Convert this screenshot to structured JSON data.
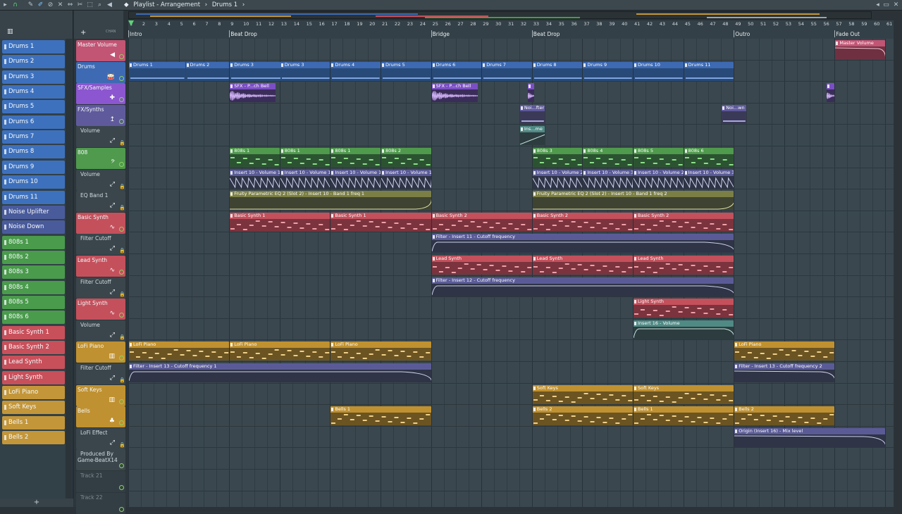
{
  "window": {
    "title": "Playlist - Arrangement",
    "pattern": "Drums 1",
    "separator": "›"
  },
  "header": {
    "chan_label": "CHAN",
    "add_label": "+"
  },
  "picker": {
    "items": [
      {
        "label": "Drums 1",
        "color": "#3e71bd"
      },
      {
        "label": "Drums 2",
        "color": "#3e71bd"
      },
      {
        "label": "Drums 3",
        "color": "#3e71bd"
      },
      {
        "label": "Drums 4",
        "color": "#3e71bd"
      },
      {
        "label": "Drums 5",
        "color": "#3e71bd"
      },
      {
        "label": "Drums 6",
        "color": "#3e71bd"
      },
      {
        "label": "Drums 7",
        "color": "#3e71bd"
      },
      {
        "label": "Drums 8",
        "color": "#3e71bd"
      },
      {
        "label": "Drums 9",
        "color": "#3e71bd"
      },
      {
        "label": "Drums 10",
        "color": "#3e71bd"
      },
      {
        "label": "Drums 11",
        "color": "#3e71bd"
      },
      {
        "label": "Noise Uplifter",
        "color": "#4a5b9c"
      },
      {
        "label": "Noise Down",
        "color": "#4a5b9c"
      },
      {
        "label": "808s 1",
        "color": "#4a9b4c"
      },
      {
        "label": "808s 2",
        "color": "#4a9b4c"
      },
      {
        "label": "808s 3",
        "color": "#4a9b4c"
      },
      {
        "label": "808s 4",
        "color": "#4a9b4c"
      },
      {
        "label": "808s 5",
        "color": "#4a9b4c"
      },
      {
        "label": "808s 6",
        "color": "#4a9b4c"
      },
      {
        "label": "Basic Synth 1",
        "color": "#c8505b"
      },
      {
        "label": "Basic Synth 2",
        "color": "#c8505b"
      },
      {
        "label": "Lead Synth",
        "color": "#c8505b"
      },
      {
        "label": "Light Synth",
        "color": "#c8505b"
      },
      {
        "label": "LoFi Piano",
        "color": "#c3963a"
      },
      {
        "label": "Soft Keys",
        "color": "#c3963a"
      },
      {
        "label": "Bells 1",
        "color": "#c3963a"
      },
      {
        "label": "Bells 2",
        "color": "#c3963a"
      }
    ],
    "add_button": "+"
  },
  "ruler": {
    "bars": [
      "1",
      "2",
      "3",
      "4",
      "5",
      "6",
      "7",
      "8",
      "9",
      "10",
      "11",
      "12",
      "13",
      "14",
      "15",
      "16",
      "17",
      "18",
      "19",
      "20",
      "21",
      "22",
      "23",
      "24",
      "25",
      "26",
      "27",
      "28",
      "29",
      "30",
      "31",
      "32",
      "33",
      "34",
      "35",
      "36",
      "37",
      "38",
      "39",
      "40",
      "41",
      "42",
      "43",
      "44",
      "45",
      "46",
      "47",
      "48",
      "49",
      "50",
      "51",
      "52",
      "53",
      "54",
      "55",
      "56",
      "57",
      "58",
      "59",
      "60",
      "61"
    ],
    "markers": [
      {
        "label": "Intro",
        "bar": 1
      },
      {
        "label": "Beat Drop",
        "bar": 9
      },
      {
        "label": "Bridge",
        "bar": 25
      },
      {
        "label": "Beat Drop",
        "bar": 33
      },
      {
        "label": "Outro",
        "bar": 49
      },
      {
        "label": "Fade Out",
        "bar": 57
      }
    ]
  },
  "tracks": [
    {
      "name": "Master Volume",
      "color": "#c25474",
      "icon": "◀",
      "kind": "led"
    },
    {
      "name": "Drums",
      "color": "#3d6ab3",
      "icon": "🥁",
      "kind": "led"
    },
    {
      "name": "SFX/Samples",
      "color": "#8b56cf",
      "icon": "✚",
      "kind": "led"
    },
    {
      "name": "FX/Synths",
      "color": "#5f5a9c",
      "icon": "↥",
      "kind": "led"
    },
    {
      "name": "Volume",
      "color": "",
      "icon": "⤢",
      "kind": "lock"
    },
    {
      "name": "808",
      "color": "#4f9a4d",
      "icon": "𝄢",
      "kind": "led"
    },
    {
      "name": "Volume",
      "color": "",
      "icon": "⤢",
      "kind": "lock"
    },
    {
      "name": "EQ Band 1",
      "color": "",
      "icon": "⤢",
      "kind": "lock"
    },
    {
      "name": "Basic Synth",
      "color": "#c4505c",
      "icon": "∿",
      "kind": "led"
    },
    {
      "name": "Filter Cutoff",
      "color": "",
      "icon": "⤢",
      "kind": "lock"
    },
    {
      "name": "Lead Synth",
      "color": "#c4505c",
      "icon": "∿",
      "kind": "led"
    },
    {
      "name": "Filter Cutoff",
      "color": "",
      "icon": "⤢",
      "kind": "lock"
    },
    {
      "name": "Light Synth",
      "color": "#c4505c",
      "icon": "∿",
      "kind": "led"
    },
    {
      "name": "Volume",
      "color": "",
      "icon": "⤢",
      "kind": "lock"
    },
    {
      "name": "LoFi Piano",
      "color": "#c09130",
      "icon": "▥",
      "kind": "led"
    },
    {
      "name": "Filter Cutoff",
      "color": "",
      "icon": "⤢",
      "kind": "lock"
    },
    {
      "name": "Soft Keys",
      "color": "#c09130",
      "icon": "▥",
      "kind": "led"
    },
    {
      "name": "Bells",
      "color": "#c09130",
      "icon": "♣",
      "kind": "led"
    },
    {
      "name": "LoFi Effect",
      "color": "",
      "icon": "⤢",
      "kind": "lock"
    },
    {
      "name": "Produced By\nGame-BeatX14",
      "color": "",
      "icon": "",
      "kind": "led"
    },
    {
      "name": "Track 21",
      "color": "",
      "icon": "",
      "kind": "led"
    },
    {
      "name": "Track 22",
      "color": "",
      "icon": "",
      "kind": "led"
    }
  ],
  "clips": [
    {
      "track": 0,
      "start": 57,
      "len": 4,
      "label": "Master Volume",
      "style": "pink",
      "auto": "down"
    },
    {
      "track": 1,
      "start": 1,
      "len": 4.5,
      "label": "Drums 1",
      "style": "blue"
    },
    {
      "track": 1,
      "start": 5.5,
      "len": 3.5,
      "label": "Drums 2",
      "style": "blue"
    },
    {
      "track": 1,
      "start": 9,
      "len": 4.5,
      "label": "Drums 3",
      "style": "blue"
    },
    {
      "track": 1,
      "start": 13,
      "len": 4,
      "label": "Drums 3",
      "style": "blue"
    },
    {
      "track": 1,
      "start": 17,
      "len": 4,
      "label": "Drums 4",
      "style": "blue"
    },
    {
      "track": 1,
      "start": 21,
      "len": 4,
      "label": "Drums 5",
      "style": "blue"
    },
    {
      "track": 1,
      "start": 25,
      "len": 4,
      "label": "Drums 6",
      "style": "blue"
    },
    {
      "track": 1,
      "start": 29,
      "len": 4,
      "label": "Drums 7",
      "style": "blue"
    },
    {
      "track": 1,
      "start": 33,
      "len": 4,
      "label": "Drums 8",
      "style": "blue"
    },
    {
      "track": 1,
      "start": 37,
      "len": 4,
      "label": "Drums 9",
      "style": "blue"
    },
    {
      "track": 1,
      "start": 41,
      "len": 4,
      "label": "Drums 10",
      "style": "blue"
    },
    {
      "track": 1,
      "start": 45,
      "len": 4,
      "label": "Drums 11",
      "style": "blue"
    },
    {
      "track": 2,
      "start": 9,
      "len": 3.7,
      "label": "SFX - P...ch Bell",
      "style": "purple",
      "wave": true
    },
    {
      "track": 2,
      "start": 25,
      "len": 3.7,
      "label": "SFX - P...ch Bell",
      "style": "purple",
      "wave": true
    },
    {
      "track": 2,
      "start": 32.6,
      "len": 0.6,
      "label": "",
      "style": "purple",
      "wave": true
    },
    {
      "track": 2,
      "start": 56.3,
      "len": 0.7,
      "label": "",
      "style": "purple",
      "wave": true
    },
    {
      "track": 3,
      "start": 32,
      "len": 2,
      "label": "Noi...fter",
      "style": "lav"
    },
    {
      "track": 3,
      "start": 48,
      "len": 2,
      "label": "Noi...wn",
      "style": "lav"
    },
    {
      "track": 4,
      "start": 32,
      "len": 2,
      "label": "Ins...me",
      "style": "teal",
      "auto": "up"
    },
    {
      "track": 5,
      "start": 9,
      "len": 4,
      "label": "808s 1",
      "style": "green",
      "notes": true
    },
    {
      "track": 5,
      "start": 13,
      "len": 4,
      "label": "808s 1",
      "style": "green",
      "notes": true
    },
    {
      "track": 5,
      "start": 17,
      "len": 4,
      "label": "808s 1",
      "style": "green",
      "notes": true
    },
    {
      "track": 5,
      "start": 21,
      "len": 4,
      "label": "808s 2",
      "style": "green",
      "notes": true
    },
    {
      "track": 5,
      "start": 33,
      "len": 4,
      "label": "808s 3",
      "style": "green",
      "notes": true
    },
    {
      "track": 5,
      "start": 37,
      "len": 4,
      "label": "808s 4",
      "style": "green",
      "notes": true
    },
    {
      "track": 5,
      "start": 41,
      "len": 4,
      "label": "808s 5",
      "style": "green",
      "notes": true
    },
    {
      "track": 5,
      "start": 45,
      "len": 4,
      "label": "808s 6",
      "style": "green",
      "notes": true
    },
    {
      "track": 6,
      "start": 9,
      "len": 4,
      "label": "Insert 10 - Volume 1",
      "style": "auto",
      "auto": "saw"
    },
    {
      "track": 6,
      "start": 13,
      "len": 4,
      "label": "Insert 10 - Volume 1",
      "style": "auto",
      "auto": "saw"
    },
    {
      "track": 6,
      "start": 17,
      "len": 4,
      "label": "Insert 10 - Volume 1",
      "style": "auto",
      "auto": "saw"
    },
    {
      "track": 6,
      "start": 21,
      "len": 4,
      "label": "Insert 10 - Volume 1",
      "style": "auto",
      "auto": "saw"
    },
    {
      "track": 6,
      "start": 33,
      "len": 4,
      "label": "Insert 10 - Volume 2",
      "style": "auto",
      "auto": "saw"
    },
    {
      "track": 6,
      "start": 37,
      "len": 4,
      "label": "Insert 10 - Volume 3",
      "style": "auto",
      "auto": "saw"
    },
    {
      "track": 6,
      "start": 41,
      "len": 4,
      "label": "Insert 10 - Volume 2",
      "style": "auto",
      "auto": "saw"
    },
    {
      "track": 6,
      "start": 45,
      "len": 4,
      "label": "Insert 10 - Volume 3",
      "style": "auto",
      "auto": "saw"
    },
    {
      "track": 7,
      "start": 9,
      "len": 16,
      "label": "Fruity Parametric EQ 2 (Slot 2) - Insert 10 - Band 1 freq 1",
      "style": "olive",
      "auto": "rise"
    },
    {
      "track": 7,
      "start": 33,
      "len": 16,
      "label": "Fruity Parametric EQ 2 (Slot 2) - Insert 10 - Band 1 freq 2",
      "style": "olive",
      "auto": "rise"
    },
    {
      "track": 8,
      "start": 9,
      "len": 8,
      "label": "Basic Synth 1",
      "style": "red",
      "notes": true
    },
    {
      "track": 8,
      "start": 17,
      "len": 8,
      "label": "Basic Synth 1",
      "style": "red",
      "notes": true
    },
    {
      "track": 8,
      "start": 25,
      "len": 8,
      "label": "Basic Synth 2",
      "style": "red",
      "notes": true
    },
    {
      "track": 8,
      "start": 33,
      "len": 8,
      "label": "Basic Synth 2",
      "style": "red",
      "notes": true
    },
    {
      "track": 8,
      "start": 41,
      "len": 8,
      "label": "Basic Synth 2",
      "style": "red",
      "notes": true
    },
    {
      "track": 9,
      "start": 25,
      "len": 24,
      "label": "Filter - Insert 11 - Cutoff frequency",
      "style": "auto",
      "auto": "drop"
    },
    {
      "track": 10,
      "start": 25,
      "len": 8,
      "label": "Lead Synth",
      "style": "red",
      "notes": true
    },
    {
      "track": 10,
      "start": 33,
      "len": 8,
      "label": "Lead Synth",
      "style": "red",
      "notes": true
    },
    {
      "track": 10,
      "start": 41,
      "len": 8,
      "label": "Lead Synth",
      "style": "red",
      "notes": true
    },
    {
      "track": 11,
      "start": 25,
      "len": 24,
      "label": "Filter - Insert 12 - Cutoff frequency",
      "style": "auto",
      "auto": "drop"
    },
    {
      "track": 12,
      "start": 41,
      "len": 8,
      "label": "Light Synth",
      "style": "red",
      "notes": true
    },
    {
      "track": 13,
      "start": 41,
      "len": 8,
      "label": "Insert 16 - Volume",
      "style": "teal",
      "auto": "drop"
    },
    {
      "track": 14,
      "start": 1,
      "len": 8,
      "label": "LoFi Piano",
      "style": "gold",
      "notes": true
    },
    {
      "track": 14,
      "start": 9,
      "len": 8,
      "label": "LoFi Piano",
      "style": "gold",
      "notes": true
    },
    {
      "track": 14,
      "start": 17,
      "len": 8,
      "label": "LoFi Piano",
      "style": "gold",
      "notes": true
    },
    {
      "track": 14,
      "start": 49,
      "len": 8,
      "label": "LoFi Piano",
      "style": "gold",
      "notes": true
    },
    {
      "track": 15,
      "start": 1,
      "len": 24,
      "label": "Filter - Insert 13 - Cutoff frequency 1",
      "style": "auto",
      "auto": "drop"
    },
    {
      "track": 15,
      "start": 49,
      "len": 8,
      "label": "Filter - Insert 13 - Cutoff frequency 2",
      "style": "auto",
      "auto": "down"
    },
    {
      "track": 16,
      "start": 33,
      "len": 8,
      "label": "Soft Keys",
      "style": "gold",
      "notes": true
    },
    {
      "track": 16,
      "start": 41,
      "len": 8,
      "label": "Soft Keys",
      "style": "gold",
      "notes": true
    },
    {
      "track": 17,
      "start": 17,
      "len": 8,
      "label": "Bells 1",
      "style": "gold",
      "notes": true
    },
    {
      "track": 17,
      "start": 33,
      "len": 8,
      "label": "Bells 2",
      "style": "gold",
      "notes": true
    },
    {
      "track": 17,
      "start": 41,
      "len": 8,
      "label": "Bells 1",
      "style": "gold",
      "notes": true
    },
    {
      "track": 17,
      "start": 49,
      "len": 8,
      "label": "Bells 2",
      "style": "gold",
      "notes": true
    },
    {
      "track": 18,
      "start": 49,
      "len": 12,
      "label": "Origin (Insert 16) - Mix level",
      "style": "auto",
      "auto": "down"
    }
  ]
}
